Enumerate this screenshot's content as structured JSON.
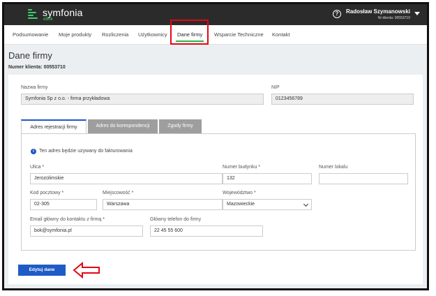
{
  "app": {
    "logo_text": "symfonia",
    "logo_sub": "eBok"
  },
  "user": {
    "name": "Radosław Szymanowski",
    "client": "Nr klienta: 00553710"
  },
  "nav": {
    "items": [
      {
        "label": "Podsumowanie"
      },
      {
        "label": "Moje produkty"
      },
      {
        "label": "Rozliczenia"
      },
      {
        "label": "Użytkownicy"
      },
      {
        "label": "Dane firmy"
      },
      {
        "label": "Wsparcie Techniczne"
      },
      {
        "label": "Kontakt"
      }
    ],
    "active_index": 4
  },
  "page": {
    "title": "Dane firmy",
    "client_number": "Numer klienta: 00553710"
  },
  "company": {
    "name_label": "Nazwa firmy",
    "name_value": "Symfonia Sp z o.o. - firma przykładowa",
    "nip_label": "NIP",
    "nip_value": "0123456789"
  },
  "tabs": [
    {
      "label": "Adres rejestracji firmy",
      "active": true
    },
    {
      "label": "Adres do korespondencji",
      "active": false
    },
    {
      "label": "Zgody firmy",
      "active": false
    }
  ],
  "address": {
    "info": "Ten adres będzie używany do fakturowania",
    "street_label": "Ulica *",
    "street_value": "Jerozolimskie",
    "building_label": "Numer budynku *",
    "building_value": "132",
    "unit_label": "Numer lokalu",
    "unit_value": "",
    "postal_label": "Kod pocztowy *",
    "postal_value": "02-305",
    "city_label": "Miejscowość *",
    "city_value": "Warszawa",
    "voivodeship_label": "Województwo *",
    "voivodeship_value": "Mazowieckie",
    "email_label": "Email główny do kontaktu z firmą *",
    "email_value": "bok@symfonia.pl",
    "phone_label": "Główny telefon do firmy",
    "phone_value": "22 45 55 600"
  },
  "actions": {
    "edit_label": "Edytuj dane"
  },
  "colors": {
    "accent_green": "#2db34a",
    "primary_blue": "#1e5bc6",
    "highlight_red": "#e30613",
    "topbar": "#2b2b2b"
  },
  "icons": {
    "help": "help-icon",
    "info": "info-icon",
    "user_menu": "chevron-down-icon",
    "annotation": "left-arrow-icon"
  }
}
